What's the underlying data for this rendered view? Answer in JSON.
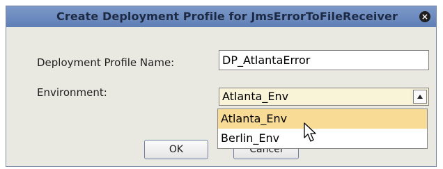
{
  "dialog": {
    "title": "Create Deployment Profile for JmsErrorToFileReceiver",
    "close_glyph": "×"
  },
  "form": {
    "profile_name_label": "Deployment Profile Name:",
    "profile_name_value": "DP_AtlantaError",
    "environment_label": "Environment:",
    "environment_value": "Atlanta_Env"
  },
  "dropdown": {
    "options": [
      "Atlanta_Env",
      "Berlin_Env"
    ],
    "selected_index": 0,
    "highlight_color": "#f8dc96"
  },
  "buttons": {
    "ok_label": "OK",
    "cancel_label": "Cancel"
  },
  "icons": {
    "close": "close-icon",
    "dropdown_arrow": "arrow-up-icon",
    "cursor": "mouse-pointer-icon"
  }
}
